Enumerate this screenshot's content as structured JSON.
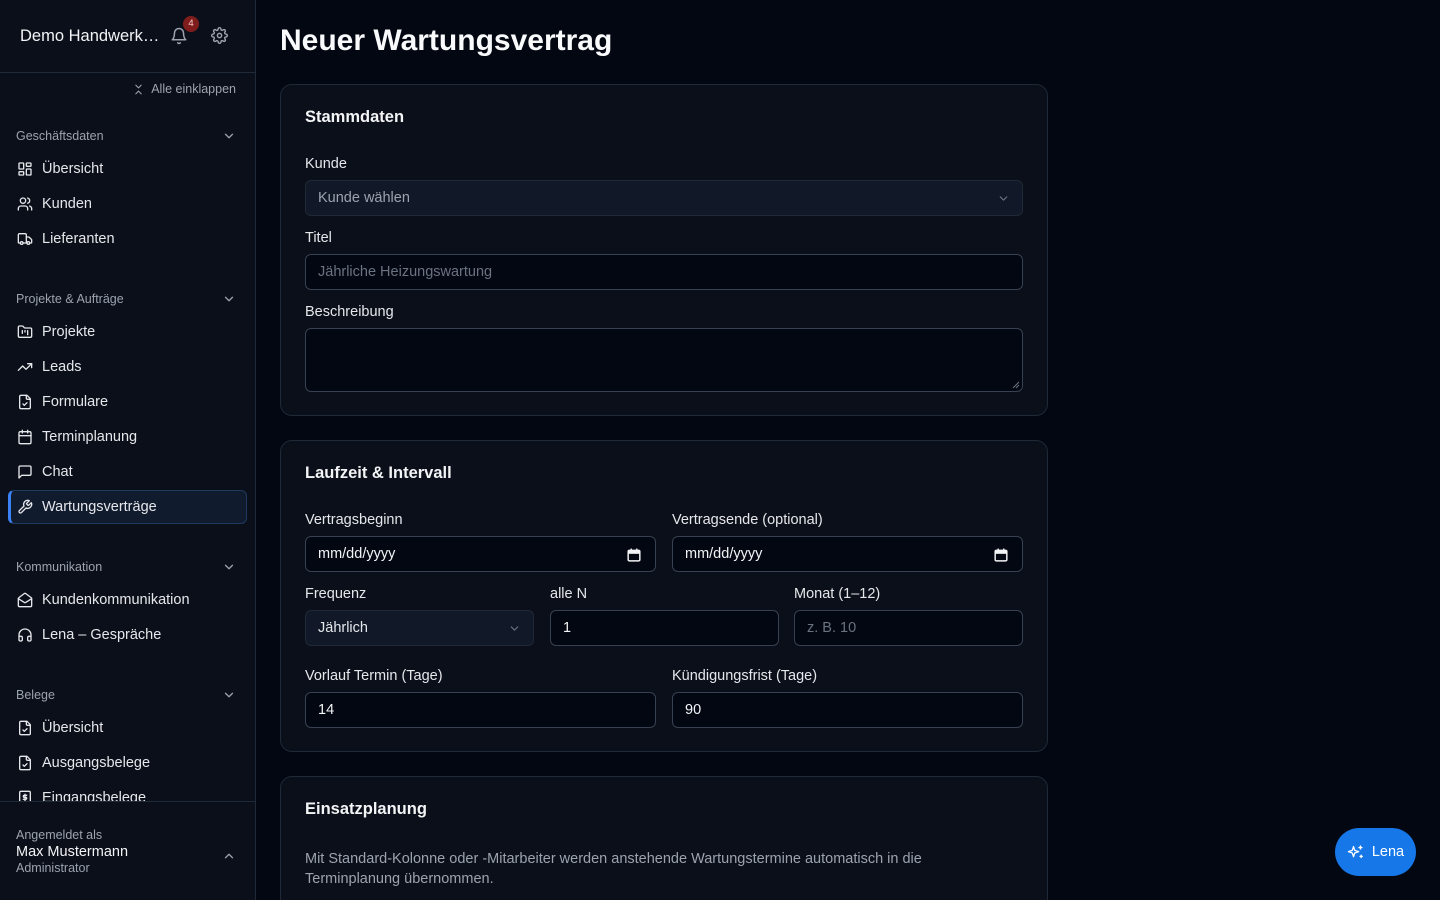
{
  "sidebar": {
    "title": "Demo Handwerksbetrieb",
    "notification_count": "4",
    "collapse_all": "Alle einklappen",
    "sections": [
      {
        "title": "Geschäftsdaten",
        "items": [
          {
            "label": "Übersicht",
            "icon": "dashboard-icon"
          },
          {
            "label": "Kunden",
            "icon": "users-icon"
          },
          {
            "label": "Lieferanten",
            "icon": "truck-icon"
          }
        ]
      },
      {
        "title": "Projekte & Aufträge",
        "items": [
          {
            "label": "Projekte",
            "icon": "folder-kanban-icon"
          },
          {
            "label": "Leads",
            "icon": "trending-up-icon"
          },
          {
            "label": "Formulare",
            "icon": "file-check-icon"
          },
          {
            "label": "Terminplanung",
            "icon": "calendar-icon"
          },
          {
            "label": "Chat",
            "icon": "message-square-icon"
          },
          {
            "label": "Wartungsverträge",
            "icon": "wrench-icon",
            "active": true
          }
        ]
      },
      {
        "title": "Kommunikation",
        "items": [
          {
            "label": "Kundenkommunikation",
            "icon": "mail-open-icon"
          },
          {
            "label": "Lena – Gespräche",
            "icon": "headphones-icon"
          }
        ]
      },
      {
        "title": "Belege",
        "items": [
          {
            "label": "Übersicht",
            "icon": "file-check-icon"
          },
          {
            "label": "Ausgangsbelege",
            "icon": "file-check-icon"
          },
          {
            "label": "Eingangsbelege",
            "icon": "receipt-icon"
          }
        ]
      }
    ],
    "footer": {
      "label": "Angemeldet als",
      "user": "Max Mustermann",
      "role": "Administrator"
    }
  },
  "page": {
    "title": "Neuer Wartungsvertrag"
  },
  "stammdaten": {
    "title": "Stammdaten",
    "kunde_label": "Kunde",
    "kunde_placeholder": "Kunde wählen",
    "titel_label": "Titel",
    "titel_placeholder": "Jährliche Heizungswartung",
    "beschreibung_label": "Beschreibung",
    "beschreibung_value": ""
  },
  "laufzeit": {
    "title": "Laufzeit & Intervall",
    "beginn_label": "Vertragsbeginn",
    "beginn_placeholder": "mm/dd/yyyy",
    "ende_label": "Vertragsende (optional)",
    "ende_placeholder": "mm/dd/yyyy",
    "frequenz_label": "Frequenz",
    "frequenz_value": "Jährlich",
    "allen_label": "alle N",
    "allen_value": "1",
    "monat_label": "Monat (1–12)",
    "monat_placeholder": "z. B. 10",
    "vorlauf_label": "Vorlauf Termin (Tage)",
    "vorlauf_value": "14",
    "kuendigung_label": "Kündigungsfrist (Tage)",
    "kuendigung_value": "90"
  },
  "einsatz": {
    "title": "Einsatzplanung",
    "hint": "Mit Standard-Kolonne oder -Mitarbeiter werden anstehende Wartungstermine automatisch in die Terminplanung übernommen."
  },
  "assistant": {
    "label": "Lena"
  },
  "colors": {
    "accent": "#3b82f6",
    "assistant_button": "#1677e8",
    "badge": "#7f1d1d"
  }
}
